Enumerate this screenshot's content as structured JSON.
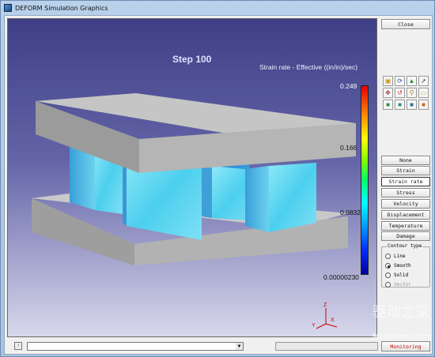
{
  "window": {
    "title": "DEFORM Simulation Graphics"
  },
  "viewport": {
    "step_label": "Step  100",
    "legend_title": "Strain rate - Effective ((in/in)/sec)",
    "legend_ticks": [
      "0.249",
      "0.166",
      "0.0832",
      "0.00000230"
    ],
    "axis_labels": {
      "z": "Z",
      "x": "X",
      "y": "Y"
    },
    "colors": {
      "background_top": "#3e3f86",
      "background_bottom": "#d8d8ec",
      "die_gray": "#b4b4b4",
      "workpiece_cyan": "#55d4f0"
    }
  },
  "sidebar": {
    "close_label": "Close",
    "tools": [
      {
        "icon": "open-folder-icon"
      },
      {
        "icon": "rotate-icon"
      },
      {
        "icon": "select-icon"
      },
      {
        "icon": "pointer-icon"
      },
      {
        "icon": "pan-icon"
      },
      {
        "icon": "undo-rotate-icon"
      },
      {
        "icon": "zoom-icon"
      },
      {
        "icon": "fit-icon"
      },
      {
        "icon": "view-cube-front-icon"
      },
      {
        "icon": "view-cube-side-icon"
      },
      {
        "icon": "view-cube-top-icon"
      },
      {
        "icon": "view-cube-iso-icon"
      }
    ],
    "variables": [
      "None",
      "Strain",
      "Strain rate",
      "Stress",
      "Velocity",
      "Displacement",
      "Temperature",
      "Damage"
    ],
    "selected_variable": "Strain rate",
    "contour_type": {
      "label": "Contour type",
      "options": [
        "Line",
        "Smooth",
        "Solid",
        "Vector"
      ],
      "selected": "Smooth",
      "disabled": [
        "Vector"
      ]
    }
  },
  "statusbar": {
    "small_button": "↑",
    "dropdown_value": "",
    "dropdown_arrow": "▼",
    "monitoring_label": "Monitoring"
  },
  "watermark": {
    "cn": "驱动之家",
    "en": "MyDrivers.com"
  }
}
